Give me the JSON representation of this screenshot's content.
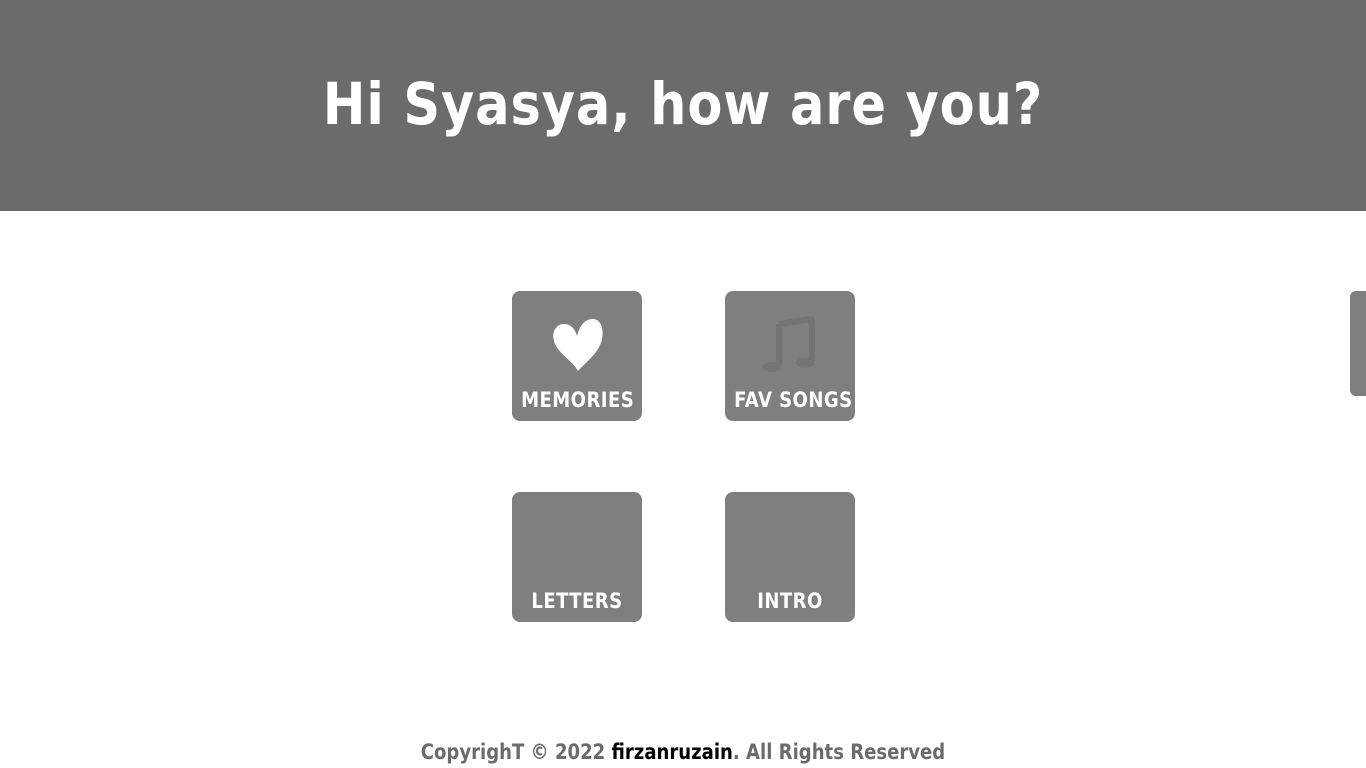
{
  "header": {
    "greeting": "Hi Syasya, how are you?"
  },
  "tiles": [
    {
      "label": "MEMORIES",
      "icon": "heart-icon"
    },
    {
      "label": "FAV SONGS",
      "icon": "music-note-icon"
    },
    {
      "label": "LETTERS",
      "icon": ""
    },
    {
      "label": "INTRO",
      "icon": ""
    }
  ],
  "footer": {
    "prefix": "CopyrighT © 2022 ",
    "author": "firzanruzain",
    "suffix": ". All Rights Reserved"
  },
  "colors": {
    "header_bg": "#6b6b6b",
    "tile_bg": "#7f7f7f",
    "tile_text": "#ffffff",
    "footer_text": "#6b6b6b",
    "author_link": "#000000"
  }
}
